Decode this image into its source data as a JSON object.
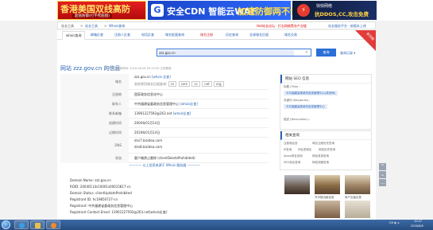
{
  "ads": {
    "ad1_line1": "香港美国双线高防",
    "ad1_line2": "超值防御(打不死赔偿)",
    "ad2_logo": "G",
    "ad2_text_white": "安全CDN 智能云WAF",
    "ad2_text_yellow": "加速防御两不误",
    "ad3_line1": "快快网络",
    "ad3_line2": "抗DDOS,CC,攻击免费",
    "ad3_icon": "⚡"
  },
  "breadcrumb": {
    "home": "站长工具",
    "sep": ">",
    "section": "站长工具",
    "page": "Whois查询",
    "hot_notice": "Hot站长论坛 · 打击网络黑灰产业链",
    "announcement": "站长服务平台 · 新版本上线"
  },
  "tabs": [
    {
      "label": "whois查询",
      "active": true,
      "red": false
    },
    {
      "label": "邮箱反查",
      "active": false,
      "red": false
    },
    {
      "label": "注册人反查",
      "active": false,
      "red": false
    },
    {
      "label": "电话反查",
      "active": false,
      "red": false
    },
    {
      "label": "域名批量查询",
      "active": false,
      "red": false
    },
    {
      "label": "域名注册",
      "active": false,
      "red": true
    },
    {
      "label": "历史查询",
      "active": false,
      "red": false
    },
    {
      "label": "全球域名后缀",
      "active": false,
      "red": false
    },
    {
      "label": "域名交易",
      "active": false,
      "red": false
    }
  ],
  "corner_badge": "新功能",
  "search": {
    "value": "zzz.gov.cn",
    "clear_icon": "×",
    "button": "查询",
    "history": "查询记录 ▾"
  },
  "site": {
    "title": "网站 zzz.gov.cn 的信息",
    "subtitle": "以下信息更新时间: 2016-06-06 00:15:00 立即更新"
  },
  "info_rows": [
    {
      "key": "域名",
      "value": "zzz.gov.cn",
      "extra": "[whois 反查]",
      "tlds_label": "其他常用域名后缀查询:",
      "tlds": [
        "cn",
        "com",
        "cc",
        "net",
        "org"
      ]
    },
    {
      "key": "注册商",
      "value": "国家政务信息化中心"
    },
    {
      "key": "联系人",
      "value": "中共福建省委政务信息管理中心",
      "extra": "[whois反查]"
    },
    {
      "key": "联系邮箱",
      "value": "13901227592@263.net",
      "extra": "[whois反查]"
    },
    {
      "key": "创建时间",
      "value": "2004年01月14日"
    },
    {
      "key": "过期时间",
      "value": "2019年01月14日"
    },
    {
      "key": "DNS",
      "value": "dns7.bizidea.com",
      "value2": "dns8.bizidea.com"
    },
    {
      "key": "状态",
      "value": "客户端禁止删除 (clientDeleteProhibited)"
    }
  ],
  "raw_heading": "———— 以上信息来源于 Whois 服务器 ————",
  "side": {
    "seo_title": "网站 SEO 信息",
    "seo_title_label": "标题 (Title) :",
    "seo_title_value": "中共福建省委政务信息管理中心(政务网)",
    "seo_keywords_label": "关键词 (Keywords) :",
    "seo_keywords_value": "中共福建省委政务信息管理中心",
    "seo_desc_label": "描述 (Description) :",
    "tools_title": "相关查询",
    "tools": [
      [
        "注册商反查",
        "域名注册历史查询"
      ],
      [
        "IP查询",
        "IP反查域名",
        "网站历史查询"
      ],
      [
        "Alexa排名查询",
        "网站收录查询"
      ],
      [
        "SEO综合查询",
        "网站测速查询"
      ]
    ]
  },
  "raw": [
    "Domain Name: zzz.gov.cn",
    "ROID: 20040114s10001s00015817-cn",
    "Domain Status: clientUpdateProhibited",
    "Registrant ID: hc19850727-cn",
    "Registrant: 中共福建省委政务信息管理中心",
    "Registrant Contact Email: 13901227592@263.net[whois反查]"
  ],
  "related": [
    {
      "caption": "写字楼出租信息"
    },
    {
      "caption": "房产出租出售"
    }
  ],
  "floats": [
    "^",
    "⌄",
    "…"
  ],
  "taskbar": {
    "tray_text": "CH  ◐  ◂",
    "time": "10:47",
    "date": "2016/6/6"
  },
  "colors": {
    "link": "#2a64b5",
    "red": "#d0272d",
    "accent_blue": "#2b6fd6"
  }
}
